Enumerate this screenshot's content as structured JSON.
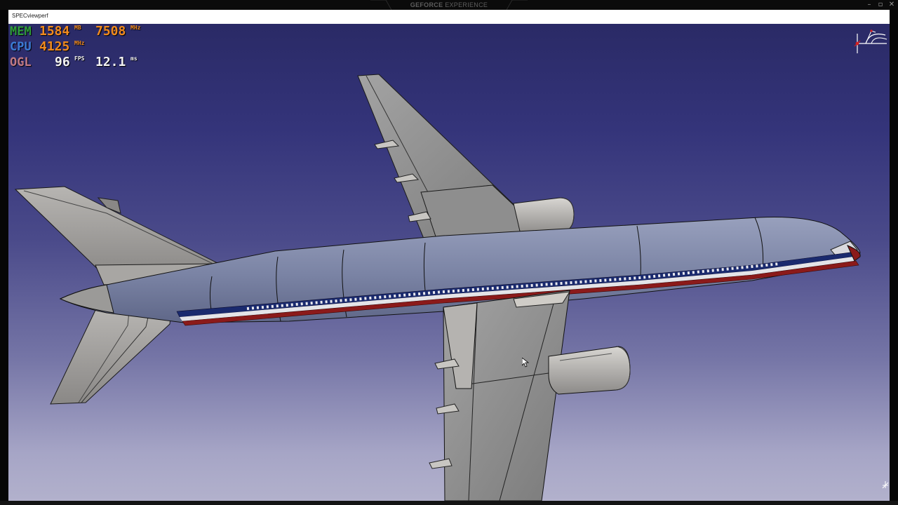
{
  "window": {
    "title": "SPECviewperf",
    "overlay_brand_bold": "GEFORCE",
    "overlay_brand_thin": "EXPERIENCE",
    "controls": [
      "–",
      "▫",
      "✕"
    ]
  },
  "hud": {
    "mem": {
      "label": "MEM",
      "value": "1584",
      "unit": "MB",
      "value2": "7508",
      "unit2": "MHz"
    },
    "cpu": {
      "label": "CPU",
      "value": "4125",
      "unit": "MHz"
    },
    "ogl": {
      "label": "OGL",
      "value": "96",
      "unit": "FPS",
      "value2": "12.1",
      "unit2": "ms"
    }
  },
  "colors": {
    "mem_label": "#2f9d3a",
    "cpu_label": "#3c7bd6",
    "ogl_label": "#c07a84",
    "hud_value": "#f08a1e",
    "hud_white": "#f2f2f2",
    "fuselage": "#7d86a6",
    "wing": "#898989",
    "stripe_red": "#8b1a1a",
    "stripe_blue": "#1a2a6e"
  },
  "viewport": {
    "model": "aircraft",
    "background": "blue-gradient",
    "compass_icon": "axis-compass-icon",
    "cursor_icon": "mouse-pointer-icon"
  }
}
